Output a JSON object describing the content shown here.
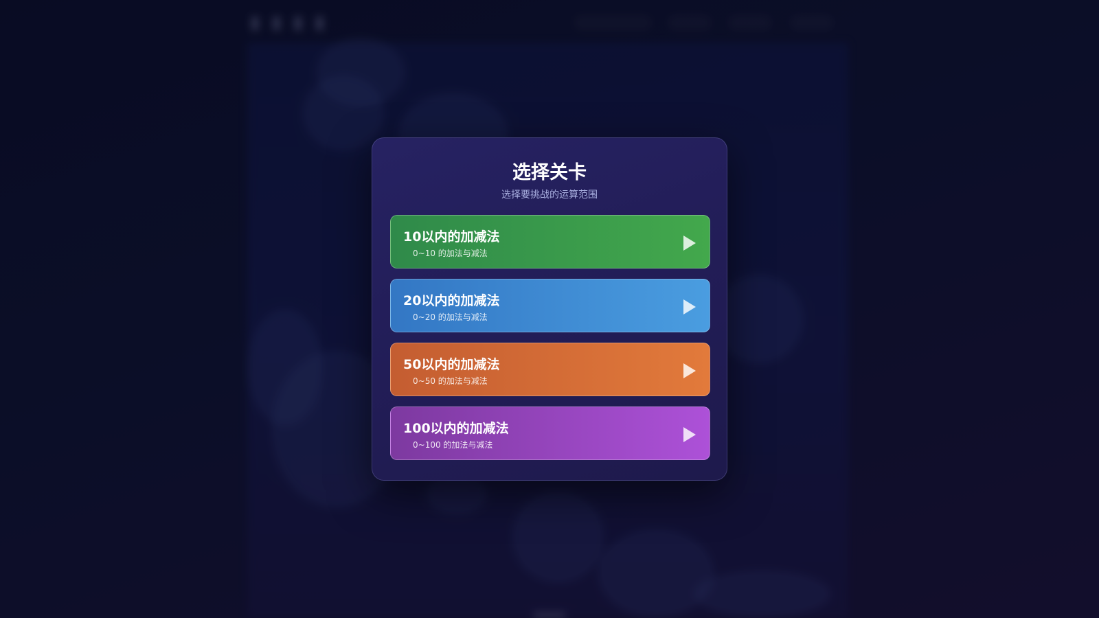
{
  "modal": {
    "title": "选择关卡",
    "subtitle": "选择要挑战的运算范围"
  },
  "levels": [
    {
      "name": "10以内的加减法",
      "desc": "0~10 的加法与减法",
      "icon": "play-icon",
      "color_start": "#2f8a4a",
      "color_end": "#43a84c"
    },
    {
      "name": "20以内的加减法",
      "desc": "0~20 的加法与减法",
      "icon": "play-icon",
      "color_start": "#3377c4",
      "color_end": "#4a9de0"
    },
    {
      "name": "50以内的加减法",
      "desc": "0~50 的加法与减法",
      "icon": "play-icon",
      "color_start": "#c45d31",
      "color_end": "#e27a3b"
    },
    {
      "name": "100以内的加减法",
      "desc": "0~100 的加法与减法",
      "icon": "play-icon",
      "color_start": "#7d39a0",
      "color_end": "#ad51d8"
    }
  ],
  "colors": {
    "modal_bg": "#262262",
    "page_bg": "#0b0e2a",
    "subtitle": "#a9afe0"
  }
}
